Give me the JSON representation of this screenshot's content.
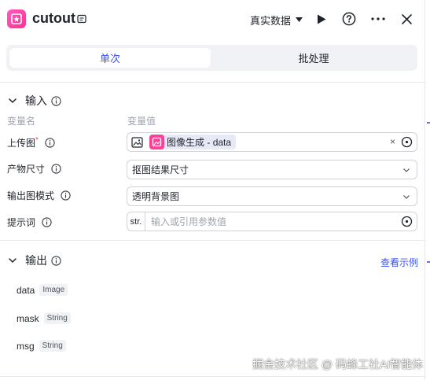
{
  "header": {
    "title": "cutout",
    "mode_label": "真实数据",
    "app_icon": "image-cutout-icon"
  },
  "tabs": [
    {
      "label": "单次",
      "active": true
    },
    {
      "label": "批处理",
      "active": false
    }
  ],
  "input_section": {
    "title": "输入",
    "col_name": "变量名",
    "col_value": "变量值",
    "rows": [
      {
        "label": "上传图",
        "required_mark": "*",
        "value_tag_source": "图像生成",
        "value_tag_sep": " - ",
        "value_tag_field": "data",
        "kind": "reference"
      },
      {
        "label": "产物尺寸",
        "value": "抠图结果尺寸",
        "kind": "select"
      },
      {
        "label": "输出图模式",
        "value": "透明背景图",
        "kind": "select"
      },
      {
        "label": "提示词",
        "prefix": "str.",
        "placeholder": "输入或引用参数值",
        "kind": "input"
      }
    ]
  },
  "output_section": {
    "title": "输出",
    "example_link": "查看示例",
    "items": [
      {
        "name": "data",
        "type": "Image"
      },
      {
        "name": "mask",
        "type": "String"
      },
      {
        "name": "msg",
        "type": "String"
      }
    ]
  },
  "watermark": "掘金技术社区 @ 码蜂工社AI智能体",
  "colors": {
    "accent": "#3a53f3",
    "brand_pink": "#ff3f9b",
    "required": "#f54a45"
  }
}
